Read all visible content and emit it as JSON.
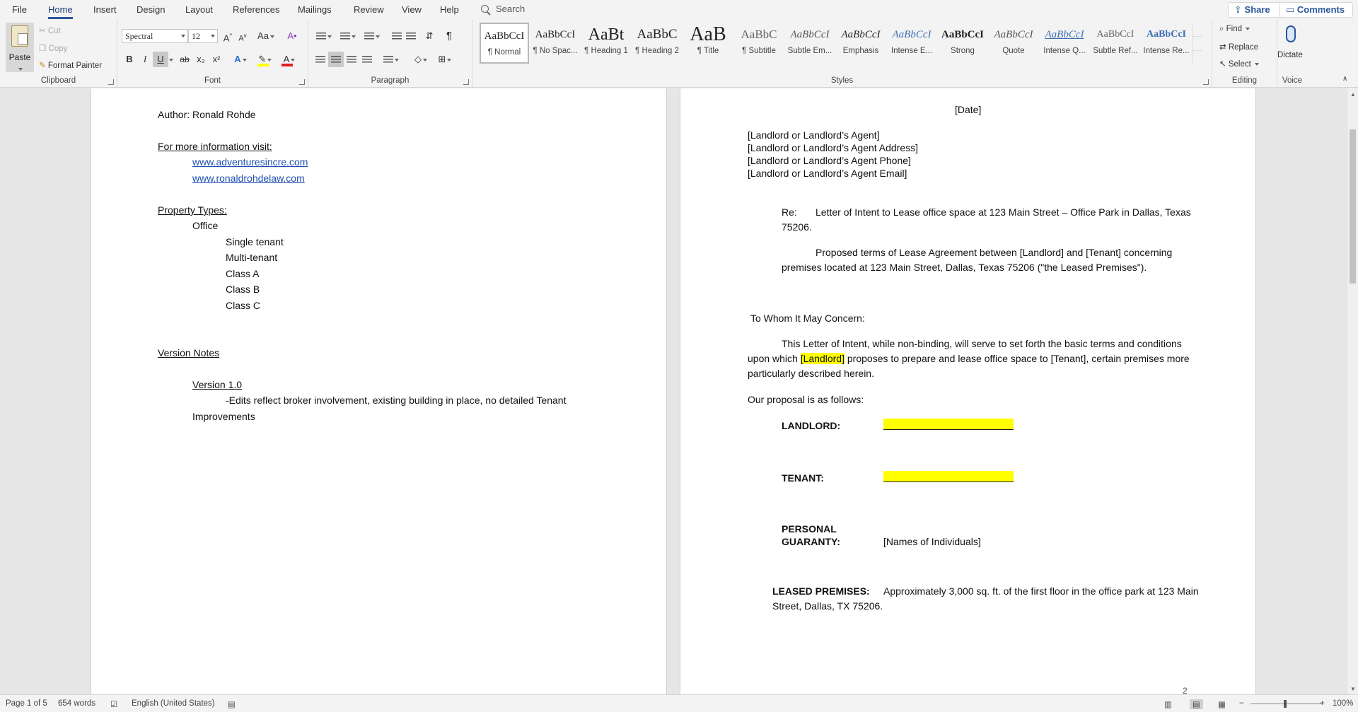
{
  "tabs": [
    "File",
    "Home",
    "Insert",
    "Design",
    "Layout",
    "References",
    "Mailings",
    "Review",
    "View",
    "Help"
  ],
  "active_tab": "Home",
  "search": {
    "label": "Search"
  },
  "top_buttons": {
    "share": "Share",
    "comments": "Comments"
  },
  "clipboard": {
    "paste": "Paste",
    "cut": "Cut",
    "copy": "Copy",
    "format_painter": "Format Painter",
    "group_label": "Clipboard"
  },
  "font": {
    "name": "Spectral",
    "size": "12",
    "change_case": "Aa",
    "bold": "B",
    "italic": "I",
    "underline": "U",
    "strike": "ab",
    "subscript": "x₂",
    "superscript": "x²",
    "grow": "A^",
    "shrink": "A˅",
    "group_label": "Font",
    "highlight_color": "#ffff00",
    "font_color": "#e02020"
  },
  "paragraph": {
    "group_label": "Paragraph",
    "pilcrow": "¶"
  },
  "styles": {
    "group_label": "Styles",
    "items": [
      {
        "preview": "AaBbCcI",
        "name": "¶ Normal"
      },
      {
        "preview": "AaBbCcI",
        "name": "¶ No Spac..."
      },
      {
        "preview": "AaBt",
        "name": "¶ Heading 1"
      },
      {
        "preview": "AaBbC",
        "name": "¶ Heading 2"
      },
      {
        "preview": "AaB",
        "name": "¶ Title"
      },
      {
        "preview": "AaBbC",
        "name": "¶ Subtitle"
      },
      {
        "preview": "AaBbCcI",
        "name": "Subtle Em..."
      },
      {
        "preview": "AaBbCcI",
        "name": "Emphasis"
      },
      {
        "preview": "AaBbCcI",
        "name": "Intense E..."
      },
      {
        "preview": "AaBbCcI",
        "name": "Strong"
      },
      {
        "preview": "AaBbCcI",
        "name": "Quote"
      },
      {
        "preview": "AaBbCcI",
        "name": "Intense Q..."
      },
      {
        "preview": "AaBbCcI",
        "name": "Subtle Ref..."
      },
      {
        "preview": "AaBbCcI",
        "name": "Intense Re..."
      }
    ]
  },
  "editing": {
    "find": "Find",
    "replace": "Replace",
    "select": "Select",
    "group_label": "Editing"
  },
  "voice": {
    "dictate": "Dictate",
    "group_label": "Voice"
  },
  "left_page": {
    "author": "Author: Ronald Rohde",
    "info_heading": "For more information visit:",
    "links": [
      "www.adventuresincre.com",
      "www.ronaldrohdelaw.com"
    ],
    "property_heading": "Property Types:",
    "office": "Office",
    "office_types": [
      "Single tenant",
      "Multi-tenant",
      "Class A",
      "Class B",
      "Class C"
    ],
    "version_heading": "Version Notes",
    "version": "Version 1.0",
    "version_note_line1": "-Edits reflect broker involvement, existing building in place, no detailed Tenant",
    "version_note_line2": "Improvements"
  },
  "right_page": {
    "date": "[Date]",
    "address_lines": [
      "[Landlord or Landlord’s Agent]",
      "[Landlord or Landlord’s Agent Address]",
      "[Landlord or Landlord’s Agent Phone]",
      "[Landlord or Landlord’s Agent Email]"
    ],
    "re_label": "Re:",
    "re_line1": "Letter of Intent to Lease office space at 123 Main Street – Office Park in Dallas, Texas",
    "re_line2": "75206.",
    "proposed_line1": "Proposed terms of Lease Agreement between [Landlord] and [Tenant] concerning",
    "proposed_line2": "premises located at 123 Main Street, Dallas, Texas 75206 (\"the Leased Premises\").",
    "salutation": "To Whom It May Concern:",
    "body_line1": "This Letter of Intent, while non-binding, will serve to set forth the basic terms and conditions",
    "body_line2_a": "upon which ",
    "body_line2_hl": "[Landlord]",
    "body_line2_b": " proposes to prepare and lease office space to [Tenant], certain premises more",
    "body_line3": "particularly described herein.",
    "proposal": "Our proposal is as follows:",
    "landlord_label": "LANDLORD:",
    "tenant_label": "TENANT:",
    "guaranty_label_1": "PERSONAL",
    "guaranty_label_2": "GUARANTY:",
    "guaranty_value": "[Names of Individuals]",
    "premises_label": "LEASED PREMISES:",
    "premises_line1": "Approximately 3,000 sq. ft. of the first floor in the office park at 123 Main",
    "premises_line2": "Street, Dallas, TX 75206.",
    "page_number": "2"
  },
  "status": {
    "page": "Page 1 of 5",
    "words": "654 words",
    "language": "English (United States)",
    "zoom": "100%"
  }
}
